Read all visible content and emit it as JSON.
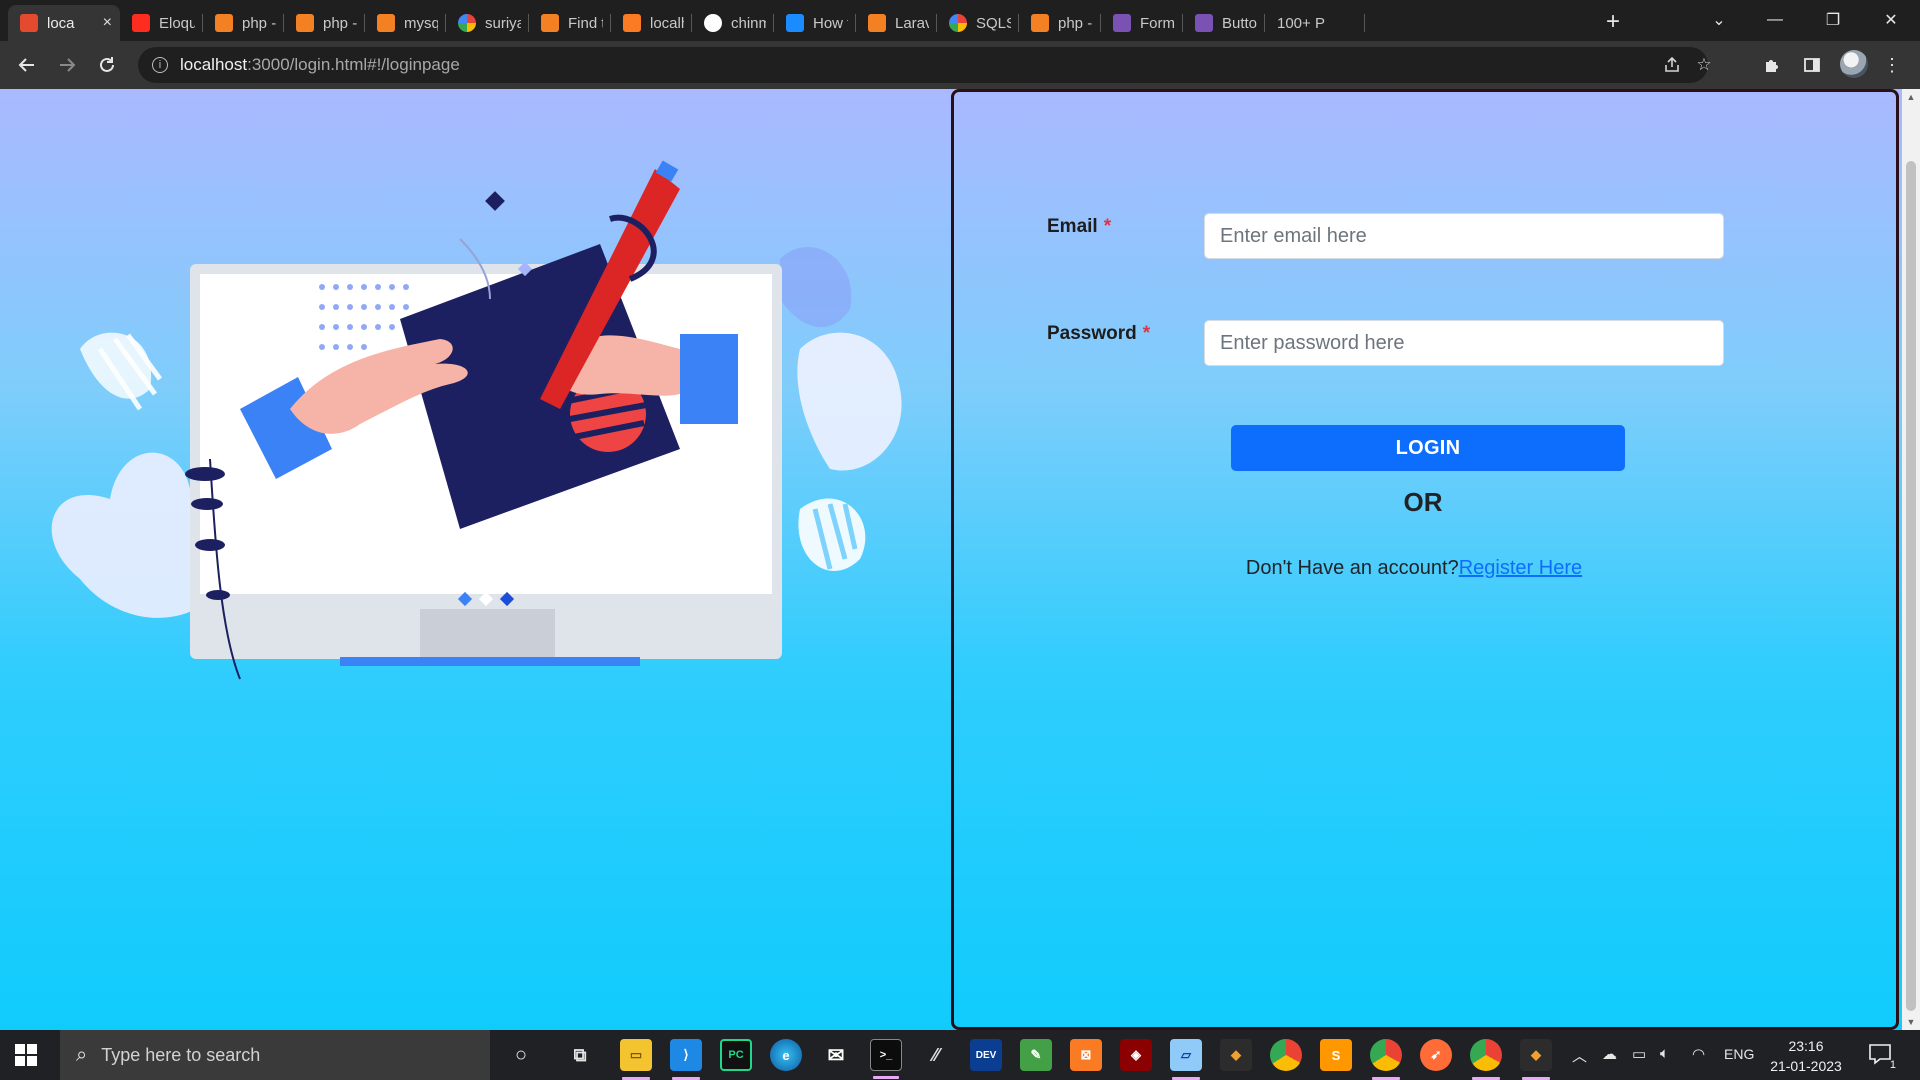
{
  "browser": {
    "tabs": [
      {
        "title": "loca",
        "favicon": "laravel-icon",
        "color": "#e34a2f",
        "active": true
      },
      {
        "title": "Eloquer",
        "favicon": "laravel-icon",
        "color": "#ff2d20"
      },
      {
        "title": "php - L",
        "favicon": "stackoverflow-icon",
        "color": "#f48024"
      },
      {
        "title": "php - H",
        "favicon": "stackoverflow-icon",
        "color": "#f48024"
      },
      {
        "title": "mysql -",
        "favicon": "stackoverflow-icon",
        "color": "#f48024"
      },
      {
        "title": "suriya r",
        "favicon": "google-icon",
        "color": "#4285f4"
      },
      {
        "title": "Find th",
        "favicon": "stackoverflow-icon",
        "color": "#f48024"
      },
      {
        "title": "localho",
        "favicon": "xampp-icon",
        "color": "#fb7a24"
      },
      {
        "title": "chinma",
        "favicon": "github-icon",
        "color": "#ffffff"
      },
      {
        "title": "How to",
        "favicon": "medium-icon",
        "color": "#1a8cff"
      },
      {
        "title": "Laravel",
        "favicon": "stackoverflow-icon",
        "color": "#f48024"
      },
      {
        "title": "SQLSTA",
        "favicon": "google-icon",
        "color": "#4285f4"
      },
      {
        "title": "php - L",
        "favicon": "stackoverflow-icon",
        "color": "#f48024"
      },
      {
        "title": "Form c",
        "favicon": "bootstrap-icon",
        "color": "#7952b3"
      },
      {
        "title": "Button",
        "favicon": "bootstrap-icon",
        "color": "#7952b3"
      },
      {
        "title": "100+ P",
        "favicon": "blank",
        "color": ""
      }
    ],
    "tab_close_glyph": "×",
    "new_tab_glyph": "+",
    "tab_search_glyph": "⌄",
    "minimize_glyph": "—",
    "restore_glyph": "❐",
    "close_window_glyph": "✕",
    "url_host": "localhost",
    "url_rest": ":3000/login.html#!/loginpage"
  },
  "page": {
    "email_label": "Email",
    "password_label": "Password",
    "required_marker": "*",
    "email_placeholder": "Enter email here",
    "password_placeholder": "Enter password here",
    "login_button": "LOGIN",
    "or_text": "OR",
    "register_prompt": "Don't Have an account?",
    "register_link": "Register Here"
  },
  "taskbar": {
    "search_placeholder": "Type here to search",
    "language": "ENG",
    "time": "23:16",
    "date": "21-01-2023",
    "notification_count": "1"
  },
  "colors": {
    "primary_button": "#0d6efd",
    "required_star": "#dc3545",
    "panel_border": "#2a0f16"
  }
}
